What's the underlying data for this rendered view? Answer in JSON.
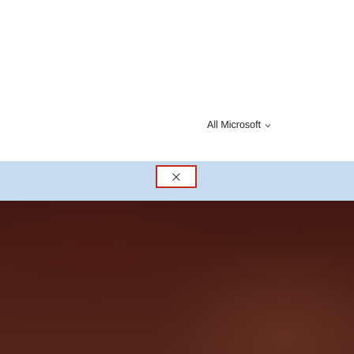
{
  "header": {
    "scope_label": "All Microsoft",
    "scope_icon": "chevron-down-icon"
  },
  "window": {
    "close_icon": "close-icon",
    "close_color": "#c42b1c",
    "band_color": "#c7dcef"
  },
  "desktop": {
    "wallpaper_color": "#4a1e15"
  }
}
